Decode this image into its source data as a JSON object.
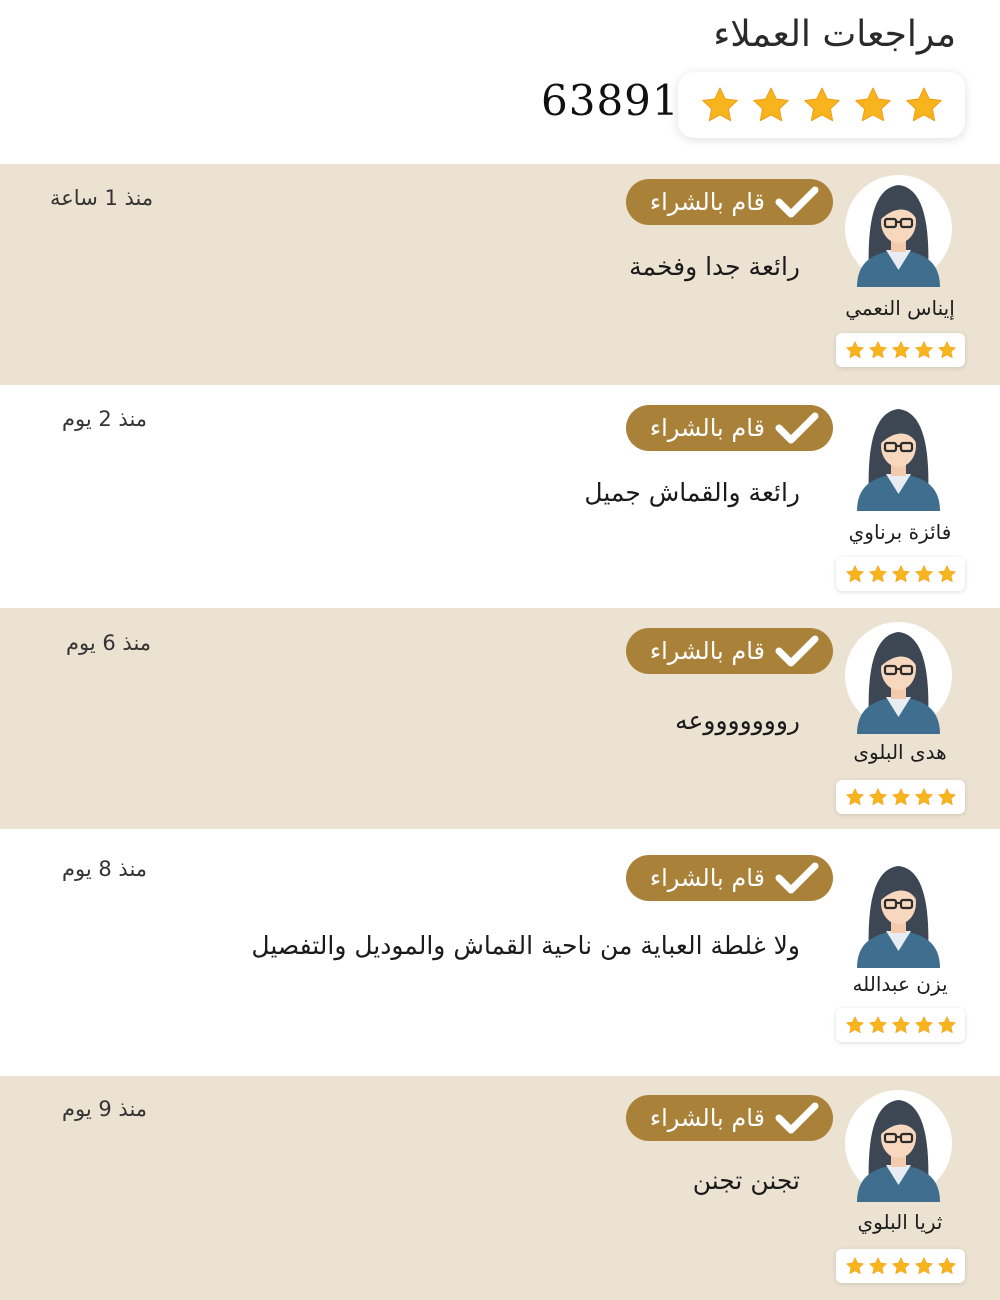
{
  "header": {
    "title": "مراجعات العملاء",
    "total_reviews": "63891",
    "rating_stars": 5
  },
  "colors": {
    "tan_background": "#ece2d2",
    "badge_gold": "#a98139",
    "star": "#f8b41d"
  },
  "icons": {
    "star": "star-icon",
    "check": "check-icon",
    "avatar": "user-avatar-icon"
  },
  "reviews": [
    {
      "name": "إيناس النعمي",
      "badge": "قام بالشراء",
      "comment": "رائعة جدا وفخمة",
      "time": "منذ 1 ساعة",
      "stars": 5
    },
    {
      "name": "فائزة برناوي",
      "badge": "قام بالشراء",
      "comment": "رائعة والقماش جميل",
      "time": "منذ 2 يوم",
      "stars": 5
    },
    {
      "name": "هدى البلوى",
      "badge": "قام بالشراء",
      "comment": "روووووووعه",
      "time": "منذ 6 يوم",
      "stars": 5
    },
    {
      "name": "يزن عبدالله",
      "badge": "قام بالشراء",
      "comment": "ولا غلطة العباية من ناحية القماش والموديل والتفصيل",
      "time": "منذ 8 يوم",
      "stars": 5
    },
    {
      "name": "ثريا البلوي",
      "badge": "قام بالشراء",
      "comment": "تجنن تجنن",
      "time": "منذ 9 يوم",
      "stars": 5
    }
  ]
}
